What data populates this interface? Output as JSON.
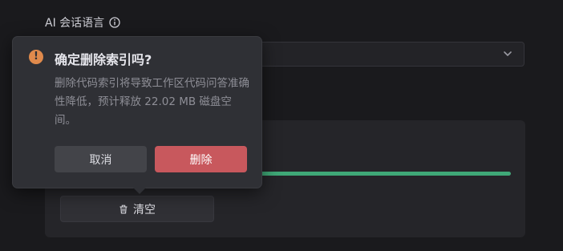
{
  "settings": {
    "ai_language_label": "AI 会话语言",
    "ai_language_value": ""
  },
  "index": {
    "progress_fraction": 1.0,
    "clear_label": "清空"
  },
  "confirm": {
    "warn_glyph": "!",
    "title": "确定删除索引吗?",
    "description": "删除代码索引将导致工作区代码问答准确性降低，预计释放 22.02 MB 磁盘空间。",
    "cancel_label": "取消",
    "delete_label": "删除"
  },
  "colors": {
    "accent_green": "#3fa877",
    "danger_red": "#c8585d",
    "warning_orange": "#e08a4c"
  },
  "icons": {
    "info": "info-icon",
    "chevron": "chevron-down-icon",
    "trash": "trash-icon",
    "warning": "warning-icon"
  }
}
